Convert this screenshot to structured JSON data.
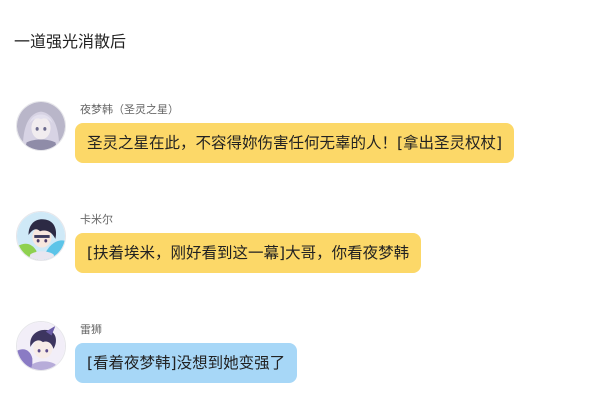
{
  "narration": "一道强光消散后",
  "colors": {
    "yellow_bubble": "#fcd868",
    "blue_bubble": "#a7d7f7"
  },
  "messages": [
    {
      "speaker": "夜梦韩（圣灵之星）",
      "text": "圣灵之星在此，不容得妳伤害任何无辜的人！[拿出圣灵权杖]",
      "bubble_color": "yellow",
      "avatar_icon": "silver-haired-girl-avatar-icon"
    },
    {
      "speaker": "卡米尔",
      "text": "[扶着埃米，刚好看到这一幕]大哥，你看夜梦韩",
      "bubble_color": "yellow",
      "avatar_icon": "dark-haired-boy-avatar-icon"
    },
    {
      "speaker": "雷狮",
      "text": "[看着夜梦韩]没想到她变强了",
      "bubble_color": "blue",
      "avatar_icon": "purple-haired-boy-avatar-icon"
    }
  ]
}
